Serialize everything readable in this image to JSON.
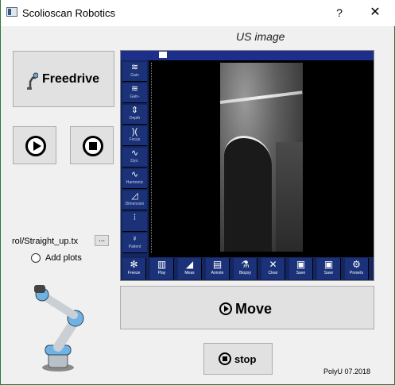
{
  "window": {
    "title": "Scolioscan Robotics",
    "help": "?",
    "close": "✕"
  },
  "us_panel": {
    "title": "US image",
    "left_controls": [
      "Gain",
      "Gain-",
      "Depth",
      "Focus",
      "Dyn.",
      "Harmonic",
      "Dimension",
      "",
      "Patient"
    ],
    "bottom_controls": [
      "Freeze",
      "Play",
      "Meas",
      "Annote",
      "Biopsy",
      "Clear",
      "Save",
      "Save",
      "Presets"
    ]
  },
  "controls": {
    "freedrive_label": "Freedrive",
    "play_icon": "play-circle-icon",
    "stop_icon": "stop-circle-icon",
    "file_path": "rol/Straight_up.tx",
    "browse_label": "...",
    "add_plots_label": "Add plots",
    "move_label": "Move",
    "stop_label": "stop"
  },
  "footer": {
    "credit": "PolyU 07.2018"
  }
}
